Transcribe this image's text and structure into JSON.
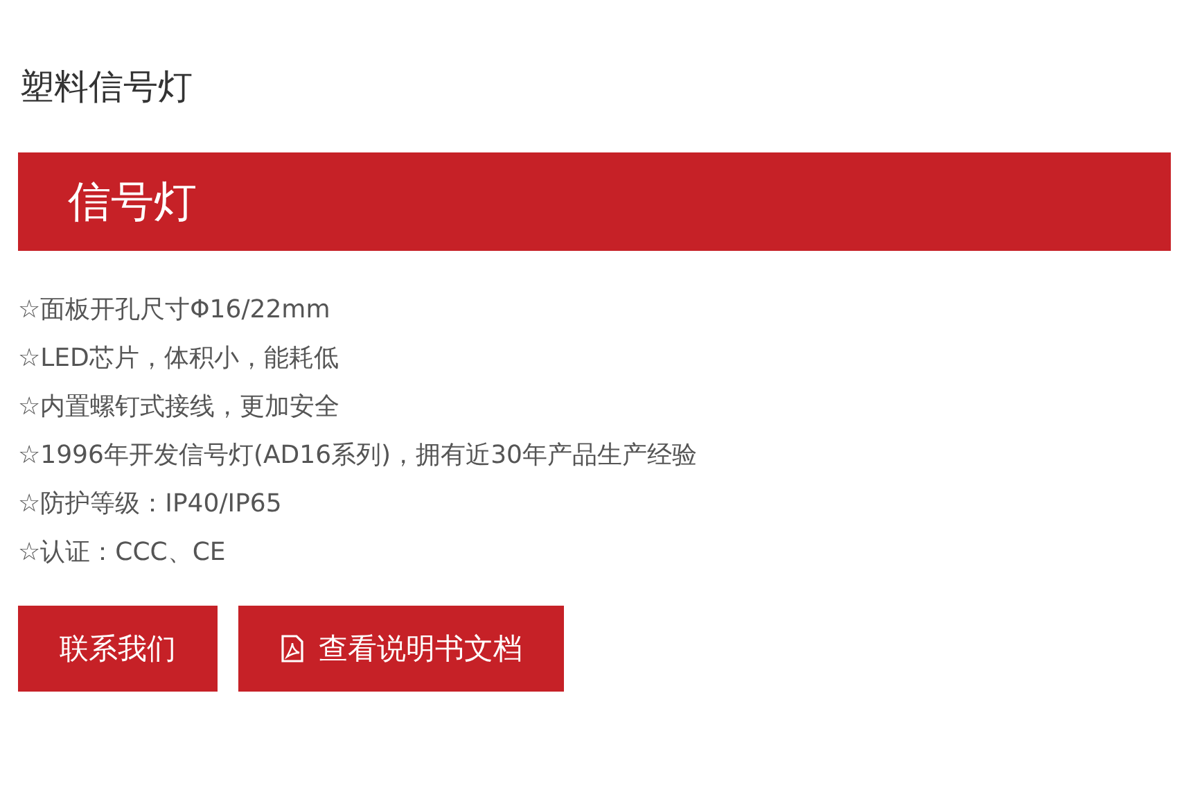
{
  "page_title": "塑料信号灯",
  "banner": {
    "title": "信号灯"
  },
  "features": [
    "☆面板开孔尺寸Φ16/22mm",
    "☆LED芯片，体积小，能耗低",
    "☆内置螺钉式接线，更加安全",
    "☆1996年开发信号灯(AD16系列)，拥有近30年产品生产经验",
    "☆防护等级：IP40/IP65",
    "☆认证：CCC、CE"
  ],
  "buttons": [
    {
      "label": "联系我们",
      "kind": "plain"
    },
    {
      "label": "查看说明书文档",
      "kind": "document"
    }
  ]
}
